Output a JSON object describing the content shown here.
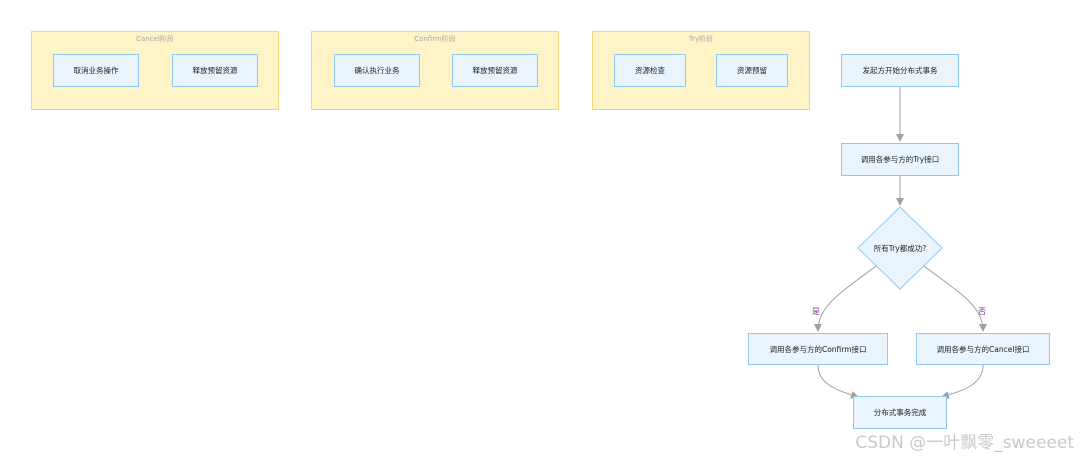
{
  "phases": {
    "cancel": {
      "title": "Cancel阶段",
      "steps": [
        "取消业务操作",
        "释放预留资源"
      ]
    },
    "confirm": {
      "title": "Confirm阶段",
      "steps": [
        "确认执行业务",
        "释放预留资源"
      ]
    },
    "try": {
      "title": "Try阶段",
      "steps": [
        "资源检查",
        "资源预留"
      ]
    }
  },
  "flow": {
    "start": "发起方开始分布式事务",
    "call_try": "调用各参与方的Try接口",
    "decision": "所有Try都成功?",
    "yes_label": "是",
    "no_label": "否",
    "call_confirm": "调用各参与方的Confirm接口",
    "call_cancel": "调用各参与方的Cancel接口",
    "done": "分布式事务完成"
  },
  "colors": {
    "phase_fill": "#fff4c8",
    "phase_border": "#f0d878",
    "node_fill": "#e9f4fd",
    "node_border": "#8fc8f0",
    "edge": "#a0a0a0",
    "edge_label": "#7a3a8a"
  },
  "watermark": "CSDN @一叶飘零_sweeeet"
}
